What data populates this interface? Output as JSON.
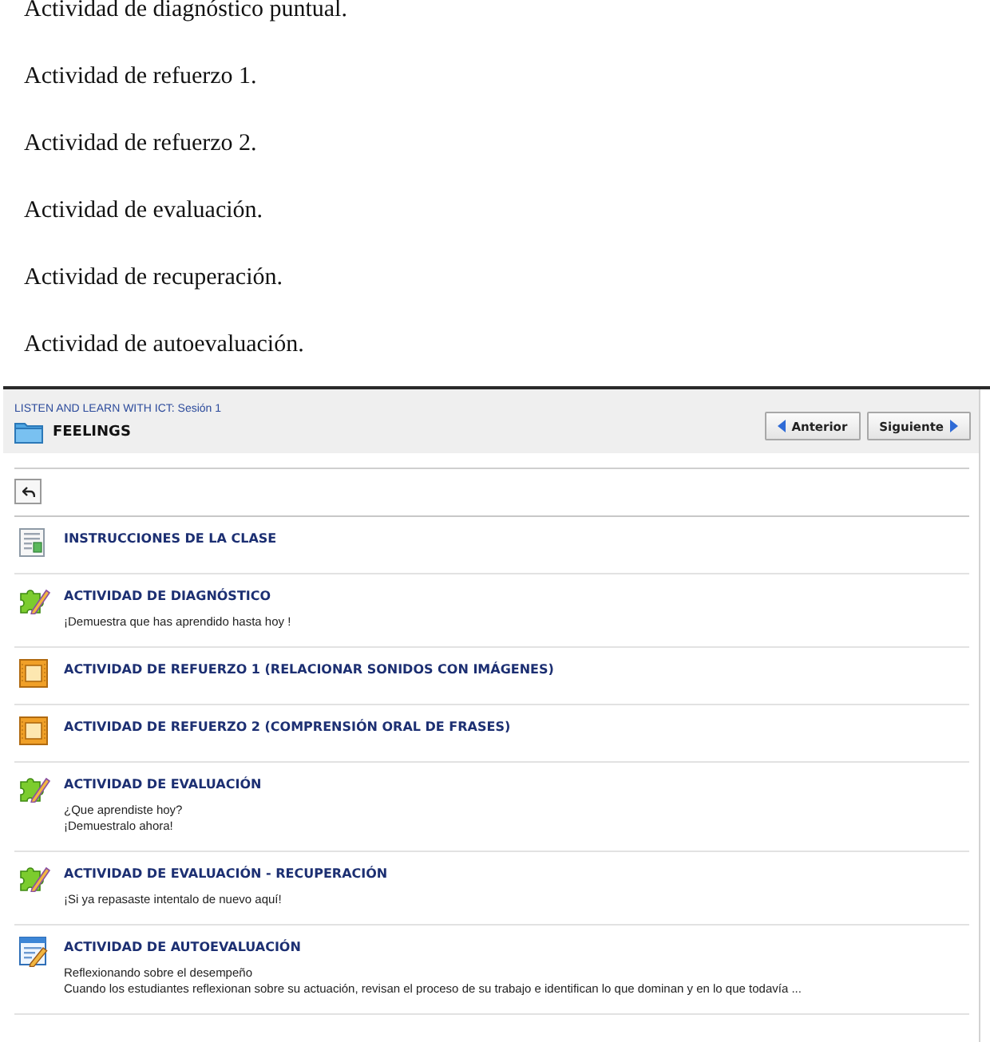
{
  "document": {
    "lines": [
      "Actividad de diagnóstico puntual.",
      "Actividad de refuerzo 1.",
      "Actividad de refuerzo 2.",
      "Actividad de evaluación.",
      "Actividad de recuperación.",
      "Actividad de autoevaluación."
    ]
  },
  "course_page": {
    "breadcrumb": "LISTEN AND LEARN WITH ICT: Sesión 1",
    "title": "FEELINGS",
    "nav_buttons": [
      {
        "kind": "previous",
        "label": "Anterior"
      },
      {
        "kind": "next",
        "label": "Siguiente"
      }
    ],
    "activities": [
      {
        "kind": "page",
        "title": "INSTRUCCIONES DE LA CLASE"
      },
      {
        "kind": "puzzle",
        "title": "ACTIVIDAD DE DIAGNÓSTICO",
        "description": [
          "¡Demuestra que has aprendido hasta hoy !"
        ]
      },
      {
        "kind": "frame",
        "title": "ACTIVIDAD DE REFUERZO 1 (RELACIONAR SONIDOS CON IMÁGENES)"
      },
      {
        "kind": "frame",
        "title": "ACTIVIDAD DE REFUERZO 2 (COMPRENSIÓN ORAL DE FRASES)"
      },
      {
        "kind": "puzzle",
        "title": "ACTIVIDAD DE EVALUACIÓN",
        "description": [
          "¿Que aprendiste hoy?",
          "¡Demuestralo ahora!"
        ]
      },
      {
        "kind": "puzzle",
        "title": "ACTIVIDAD DE EVALUACIÓN - RECUPERACIÓN",
        "description": [
          "¡Si ya repasaste intentalo de nuevo aquí!"
        ]
      },
      {
        "kind": "form",
        "title": "ACTIVIDAD DE AUTOEVALUACIÓN",
        "description": [
          "Reflexionando sobre el desempeño",
          "Cuando los estudiantes reflexionan sobre su actuación, revisan el proceso de su trabajo e identifican lo que dominan y en lo que todavía ..."
        ]
      }
    ]
  }
}
